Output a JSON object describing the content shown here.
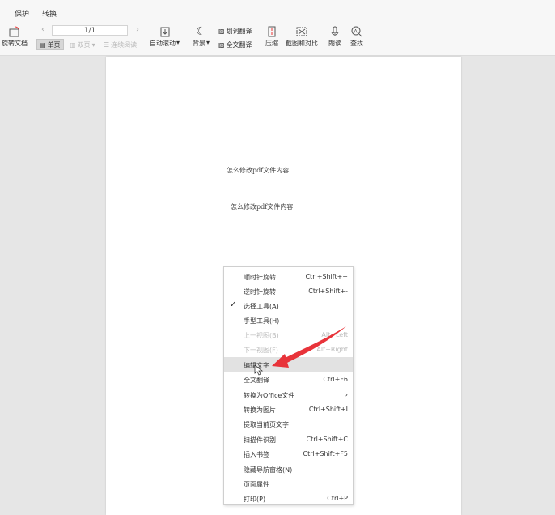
{
  "menubar": {
    "protect": "保护",
    "convert": "转换"
  },
  "toolbar": {
    "rotate_doc": "旋转文档",
    "page_indicator": "1/1",
    "single_page": "单页",
    "double_page": "双页",
    "continuous_read": "连续阅读",
    "auto_scroll": "自动滚动",
    "background": "背景",
    "word_translate": "划词翻译",
    "full_translate": "全文翻译",
    "compress": "压缩",
    "screenshot_compare": "截图和对比",
    "read_aloud": "朗读",
    "find": "查找",
    "dropdown_mark": "▾"
  },
  "document": {
    "line1": "怎么修改pdf文件内容",
    "line2": "怎么修改pdf文件内容"
  },
  "context_menu": {
    "items": [
      {
        "label": "顺时针旋转",
        "shortcut": "Ctrl+Shift++"
      },
      {
        "label": "逆时针旋转",
        "shortcut": "Ctrl+Shift+-"
      },
      {
        "label": "选择工具(A)",
        "shortcut": ""
      },
      {
        "label": "手型工具(H)",
        "shortcut": ""
      },
      {
        "label": "上一视图(B)",
        "shortcut": "Alt+Left"
      },
      {
        "label": "下一视图(F)",
        "shortcut": "Alt+Right"
      },
      {
        "label": "编辑文字",
        "shortcut": ""
      },
      {
        "label": "全文翻译",
        "shortcut": "Ctrl+F6"
      },
      {
        "label": "转换为Office文件",
        "shortcut": "›"
      },
      {
        "label": "转换为图片",
        "shortcut": "Ctrl+Shift+I"
      },
      {
        "label": "提取当前页文字",
        "shortcut": ""
      },
      {
        "label": "扫描件识别",
        "shortcut": "Ctrl+Shift+C"
      },
      {
        "label": "插入书签",
        "shortcut": "Ctrl+Shift+F5"
      },
      {
        "label": "隐藏导航窗格(N)",
        "shortcut": ""
      },
      {
        "label": "页面属性",
        "shortcut": ""
      },
      {
        "label": "打印(P)",
        "shortcut": "Ctrl+P"
      }
    ]
  },
  "colors": {
    "annotation_arrow": "#e8333a",
    "menu_hover": "#e2e2e2"
  }
}
